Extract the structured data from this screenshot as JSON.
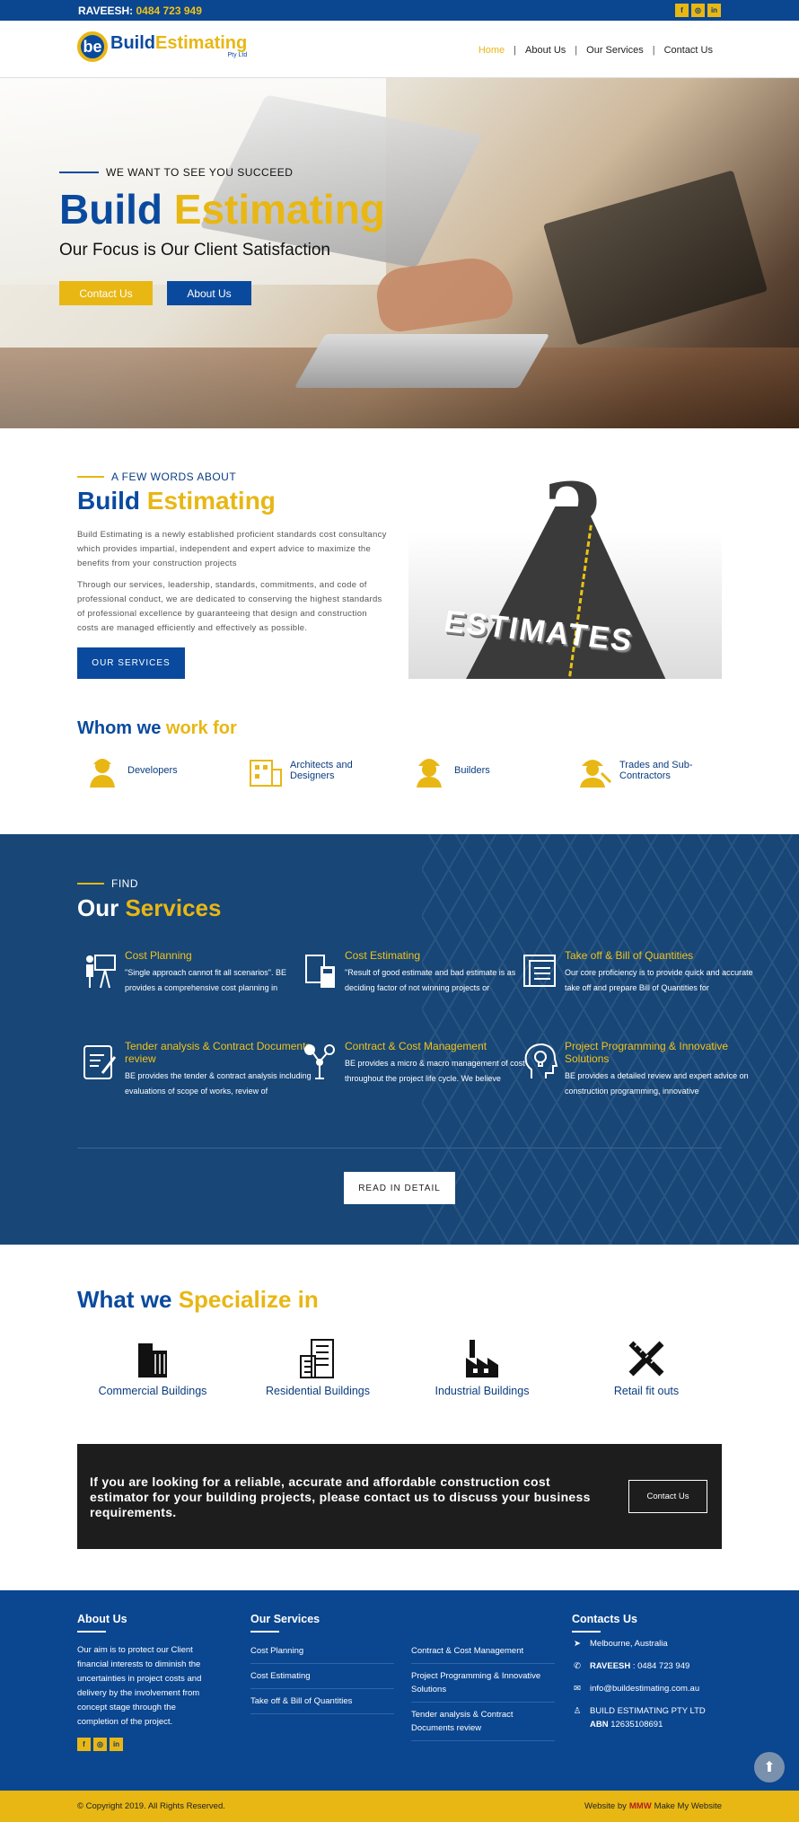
{
  "topbar": {
    "name": "RAVEESH:",
    "phone": "0484 723 949",
    "social": [
      "f",
      "ig",
      "in"
    ]
  },
  "logo": {
    "build": "Build",
    "estimating": "Estimating",
    "sub": "Pty Ltd",
    "mark": "be"
  },
  "nav": [
    "Home",
    "About Us",
    "Our Services",
    "Contact Us"
  ],
  "hero": {
    "tagline": "WE WANT TO SEE YOU SUCCEED",
    "title_a": "Build",
    "title_b": "Estimating",
    "subtitle": "Our Focus is Our Client Satisfaction",
    "btn_contact": "Contact Us",
    "btn_about": "About Us"
  },
  "about": {
    "tagline": "A FEW WORDS ABOUT",
    "title_a": "Build",
    "title_b": "Estimating",
    "p1": "Build Estimating is a newly established proficient standards cost consultancy which provides impartial, independent and expert advice to maximize the benefits from your construction projects",
    "p2": "Through our services, leadership, standards, commitments, and code of professional conduct, we are dedicated to conserving the highest standards of professional excellence by guaranteeing that design and construction costs are managed efficiently and effectively as possible.",
    "btn": "OUR SERVICES",
    "image_word": "ESTIMATES"
  },
  "whom": {
    "title_a": "Whom we",
    "title_b": "work for",
    "items": [
      "Developers",
      "Architects and Designers",
      "Builders",
      "Trades and Sub-Contractors"
    ]
  },
  "services": {
    "tagline": "FIND",
    "title_a": "Our",
    "title_b": "Services",
    "btn": "READ IN DETAIL",
    "items": [
      {
        "title": "Cost Planning",
        "desc": "\"Single approach cannot fit all scenarios\". BE provides a comprehensive cost planning in"
      },
      {
        "title": "Cost Estimating",
        "desc": "\"Result of good estimate and bad estimate is as deciding factor of not winning projects or"
      },
      {
        "title": "Take off & Bill of Quantities",
        "desc": "Our core proficiency is to provide quick and accurate take off and prepare Bill of Quantities for"
      },
      {
        "title": "Tender analysis & Contract Documents review",
        "desc": "BE provides the tender & contract analysis including evaluations of scope of works, review of"
      },
      {
        "title": "Contract & Cost Management",
        "desc": "BE provides a micro & macro management of cost throughout the project life cycle. We believe"
      },
      {
        "title": "Project Programming & Innovative Solutions",
        "desc": "BE provides a detailed review and expert advice on construction programming, innovative"
      }
    ]
  },
  "specialize": {
    "title_a": "What we",
    "title_b": "Specialize in",
    "items": [
      "Commercial Buildings",
      "Residential Buildings",
      "Industrial Buildings",
      "Retail fit outs"
    ]
  },
  "cta": {
    "text": "If you are looking for a reliable, accurate and affordable construction cost estimator for your building projects, please contact us to discuss your business requirements.",
    "btn": "Contact Us"
  },
  "footer": {
    "about_h": "About Us",
    "about_p": "Our aim is to protect our Client financial interests to diminish the uncertainties in project costs and delivery by the involvement from concept stage through the completion of the project.",
    "services_h": "Our Services",
    "col1": [
      "Cost Planning",
      "Cost Estimating",
      "Take off & Bill of Quantities"
    ],
    "col2": [
      "Contract & Cost Management",
      "Project Programming & Innovative Solutions",
      "Tender analysis & Contract Documents review"
    ],
    "contacts_h": "Contacts Us",
    "location": "Melbourne, Australia",
    "phone_name": "RAVEESH",
    "phone": " : 0484 723 949",
    "email": "info@buildestimating.com.au",
    "company": "BUILD ESTIMATING PTY LTD",
    "abn_label": "ABN",
    "abn": " 12635108691"
  },
  "copyright": "© Copyright 2019. All Rights Reserved.",
  "credit_a": "Website by",
  "credit_logo": "MMW",
  "credit_b": "Make My Website",
  "colors": {
    "blue": "#0a4a9e",
    "gold": "#e8b714",
    "navy": "#174677"
  }
}
